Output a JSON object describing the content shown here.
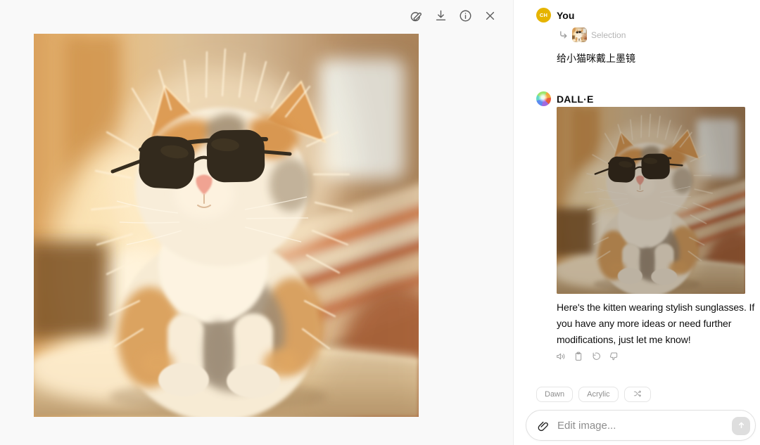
{
  "colors": {
    "canvas_background": "#f9f9f9",
    "panel_background": "#ffffff",
    "user_avatar": "#e6b400",
    "muted_text": "#b4b4b4",
    "chip_text": "#8e8e8e",
    "body_text": "#0d0d0d"
  },
  "image_toolbar": {
    "icons": [
      "select-icon",
      "download-icon",
      "info-icon",
      "close-icon"
    ]
  },
  "conversation": {
    "user": {
      "name": "You",
      "avatar_initials": "CH",
      "reference": {
        "label": "Selection",
        "icon": "reply-arrow-icon"
      },
      "message": "给小猫咪戴上墨镜"
    },
    "assistant": {
      "name": "DALL·E",
      "message": "Here's the kitten wearing stylish sunglasses. If you have any more ideas or need further modifications, just let me know!",
      "action_icons": [
        "read-aloud-icon",
        "copy-icon",
        "regenerate-icon",
        "thumbs-down-icon"
      ]
    }
  },
  "style_chips": {
    "chip1": "Dawn",
    "chip2": "Acrylic",
    "shuffle_icon": "shuffle-icon"
  },
  "composer": {
    "placeholder": "Edit image...",
    "attach_icon": "paperclip-icon",
    "send_icon": "arrow-up-icon"
  }
}
